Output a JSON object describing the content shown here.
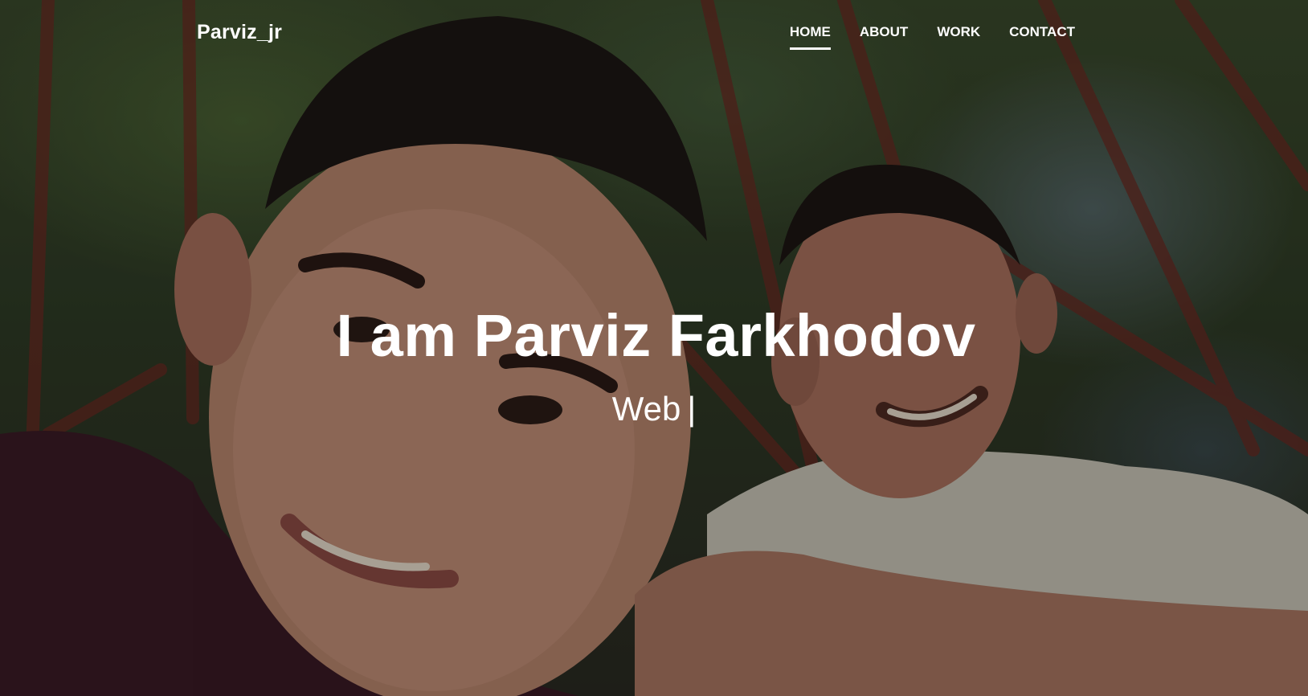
{
  "navbar": {
    "brand": "Parviz_jr",
    "links": [
      {
        "label": "HOME",
        "active": true
      },
      {
        "label": "ABOUT",
        "active": false
      },
      {
        "label": "WORK",
        "active": false
      },
      {
        "label": "CONTACT",
        "active": false
      }
    ]
  },
  "hero": {
    "title": "I am Parviz Farkhodov",
    "subtitle": "Web",
    "cursor": "|",
    "background_image": "photo-of-two-young-men-smiling"
  },
  "colors": {
    "text": "#ffffff",
    "overlay": "#000000"
  }
}
